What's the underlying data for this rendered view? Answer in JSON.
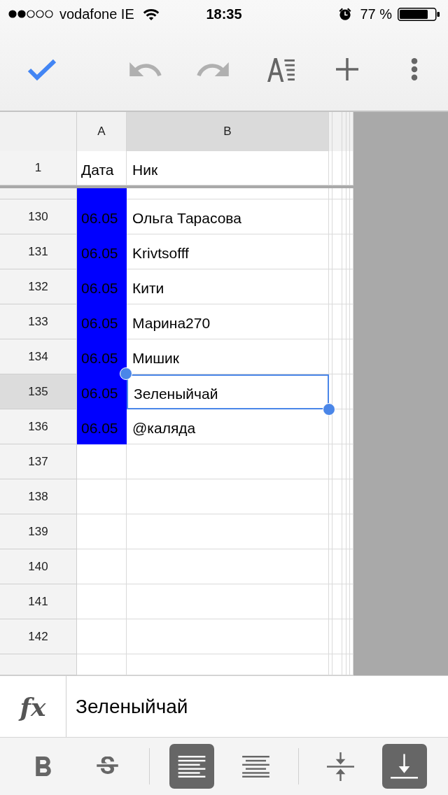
{
  "status_bar": {
    "carrier": "vodafone IE",
    "time": "18:35",
    "battery": "77 %"
  },
  "toolbar": [
    {
      "kind": "done",
      "disabled": false
    },
    {
      "kind": "undo",
      "disabled": true
    },
    {
      "kind": "redo",
      "disabled": true
    },
    {
      "kind": "format",
      "disabled": false
    },
    {
      "kind": "insert",
      "disabled": false
    },
    {
      "kind": "more",
      "disabled": false
    }
  ],
  "columns": [
    {
      "label": "A",
      "selected": false
    },
    {
      "label": "B",
      "selected": true
    }
  ],
  "frozen_row": {
    "number": "1",
    "cells": [
      {
        "text": "Дата"
      },
      {
        "text": "Ник"
      }
    ]
  },
  "top_partial_row": {
    "cells": [
      {
        "color": "#0000ff"
      }
    ]
  },
  "rows": [
    {
      "number": "130",
      "selected": false,
      "cells": [
        {
          "text": "06.05",
          "color": "#0000ff",
          "selected": false
        },
        {
          "text": "Ольга Тарасова",
          "selected": false
        }
      ]
    },
    {
      "number": "131",
      "selected": false,
      "cells": [
        {
          "text": "06.05",
          "color": "#0000ff",
          "selected": false
        },
        {
          "text": "Krivtsofff",
          "selected": false
        }
      ]
    },
    {
      "number": "132",
      "selected": false,
      "cells": [
        {
          "text": "06.05",
          "color": "#0000ff",
          "selected": false
        },
        {
          "text": "Кити",
          "selected": false
        }
      ]
    },
    {
      "number": "133",
      "selected": false,
      "cells": [
        {
          "text": "06.05",
          "color": "#0000ff",
          "selected": false
        },
        {
          "text": "Марина270",
          "selected": false
        }
      ]
    },
    {
      "number": "134",
      "selected": false,
      "cells": [
        {
          "text": "06.05",
          "color": "#0000ff",
          "selected": false
        },
        {
          "text": "Мишик",
          "selected": false
        }
      ]
    },
    {
      "number": "135",
      "selected": true,
      "cells": [
        {
          "text": "06.05",
          "color": "#0000ff",
          "selected": false
        },
        {
          "text": "Зеленыйчай",
          "selected": true
        }
      ]
    },
    {
      "number": "136",
      "selected": false,
      "cells": [
        {
          "text": "06.05",
          "color": "#0000ff",
          "selected": false
        },
        {
          "text": "@каляда",
          "selected": false
        }
      ]
    },
    {
      "number": "137",
      "selected": false
    },
    {
      "number": "138",
      "selected": false
    },
    {
      "number": "139",
      "selected": false
    },
    {
      "number": "140",
      "selected": false
    },
    {
      "number": "141",
      "selected": false
    },
    {
      "number": "142",
      "selected": false
    }
  ],
  "formula_bar": {
    "label": "fx",
    "value": "Зеленыйчай"
  },
  "format_toolbar": {
    "groups": [
      {
        "items": [
          {
            "kind": "bold",
            "selected": false
          },
          {
            "kind": "strikethrough",
            "selected": false
          }
        ]
      },
      {
        "items": [
          {
            "kind": "align_left",
            "selected": true
          },
          {
            "kind": "align_center",
            "selected": false
          }
        ]
      },
      {
        "items": [
          {
            "kind": "valign_middle",
            "selected": false
          },
          {
            "kind": "valign_bottom",
            "selected": true
          }
        ]
      }
    ]
  }
}
